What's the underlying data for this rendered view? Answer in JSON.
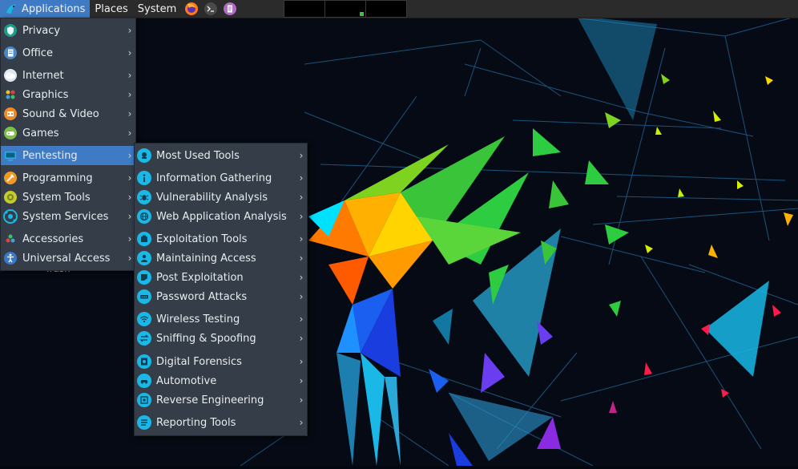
{
  "panel": {
    "applications_label": "Applications",
    "places_label": "Places",
    "system_label": "System",
    "launchers": [
      {
        "icon": "firefox-icon"
      },
      {
        "icon": "terminal-icon"
      },
      {
        "icon": "text-editor-icon"
      }
    ]
  },
  "desktop": {
    "trash_label": "Trash"
  },
  "app_menu": {
    "items": [
      {
        "label": "Privacy",
        "icon": "privacy-icon"
      },
      {
        "label": "Office",
        "icon": "office-icon"
      },
      {
        "label": "Internet",
        "icon": "internet-icon"
      },
      {
        "label": "Graphics",
        "icon": "graphics-icon"
      },
      {
        "label": "Sound & Video",
        "icon": "sound-video-icon"
      },
      {
        "label": "Games",
        "icon": "games-icon"
      },
      {
        "label": "Pentesting",
        "icon": "pentesting-icon",
        "highlighted": true
      },
      {
        "label": "Programming",
        "icon": "programming-icon"
      },
      {
        "label": "System Tools",
        "icon": "system-tools-icon"
      },
      {
        "label": "System Services",
        "icon": "system-services-icon"
      },
      {
        "label": "Accessories",
        "icon": "accessories-icon"
      },
      {
        "label": "Universal Access",
        "icon": "universal-access-icon"
      }
    ]
  },
  "pentest_menu": {
    "items": [
      {
        "label": "Most Used Tools",
        "icon": "most-used-tools-icon"
      },
      {
        "label": "Information Gathering",
        "icon": "information-gathering-icon"
      },
      {
        "label": "Vulnerability Analysis",
        "icon": "vulnerability-analysis-icon"
      },
      {
        "label": "Web Application Analysis",
        "icon": "web-application-analysis-icon"
      },
      {
        "label": "Exploitation Tools",
        "icon": "exploitation-tools-icon"
      },
      {
        "label": "Maintaining Access",
        "icon": "maintaining-access-icon"
      },
      {
        "label": "Post Exploitation",
        "icon": "post-exploitation-icon"
      },
      {
        "label": "Password Attacks",
        "icon": "password-attacks-icon"
      },
      {
        "label": "Wireless Testing",
        "icon": "wireless-testing-icon"
      },
      {
        "label": "Sniffing & Spoofing",
        "icon": "sniffing-spoofing-icon"
      },
      {
        "label": "Digital Forensics",
        "icon": "digital-forensics-icon"
      },
      {
        "label": "Automotive",
        "icon": "automotive-icon"
      },
      {
        "label": "Reverse Engineering",
        "icon": "reverse-engineering-icon"
      },
      {
        "label": "Reporting Tools",
        "icon": "reporting-tools-icon"
      }
    ]
  },
  "colors": {
    "panel_bg": "#2b2b2b",
    "menu_bg": "#343d48",
    "highlight": "#3e7bc4",
    "submenu_icon": "#19b8e6"
  }
}
